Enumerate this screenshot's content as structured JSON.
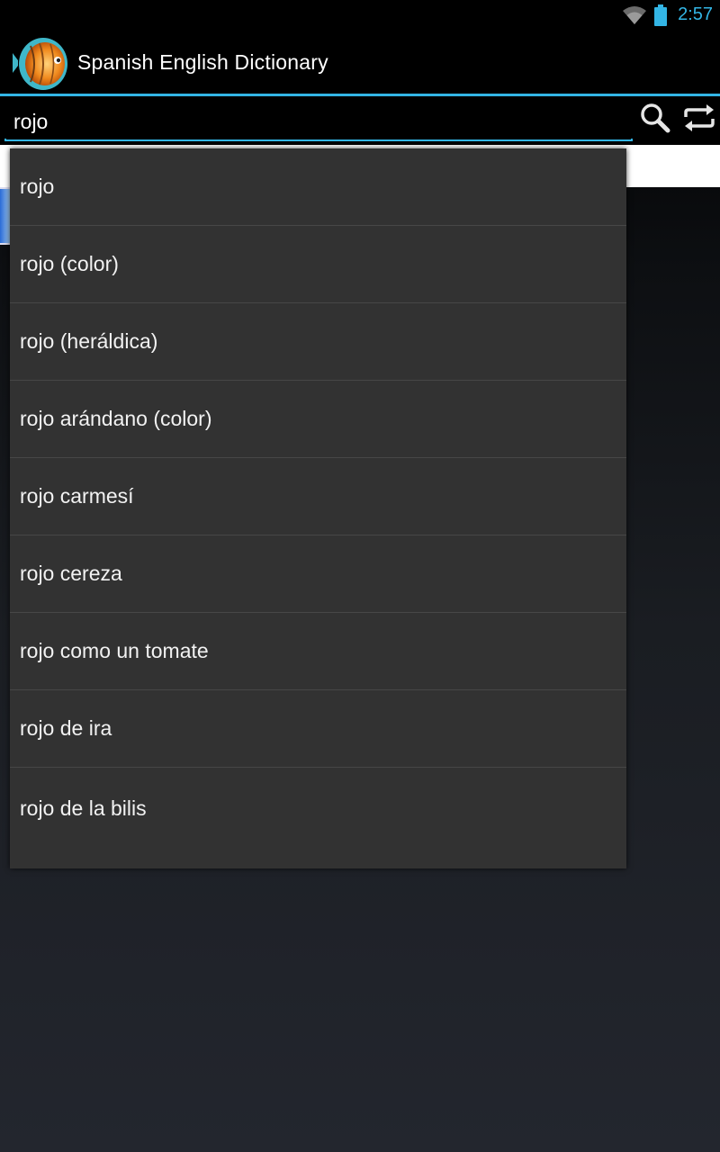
{
  "status_bar": {
    "time": "2:57",
    "icons": [
      "wifi-icon",
      "battery-icon"
    ],
    "accent_color": "#33b5e5"
  },
  "action_bar": {
    "title": "Spanish English Dictionary",
    "icon": "fish-app-icon"
  },
  "search": {
    "value": "rojo",
    "search_icon": "search-icon",
    "swap_icon": "swap-direction-icon"
  },
  "suggestions": [
    "rojo",
    "rojo (color)",
    "rojo (heráldica)",
    "rojo arándano (color)",
    "rojo carmesí",
    "rojo cereza",
    "rojo como un tomate",
    "rojo de ira",
    "rojo de la bilis"
  ]
}
